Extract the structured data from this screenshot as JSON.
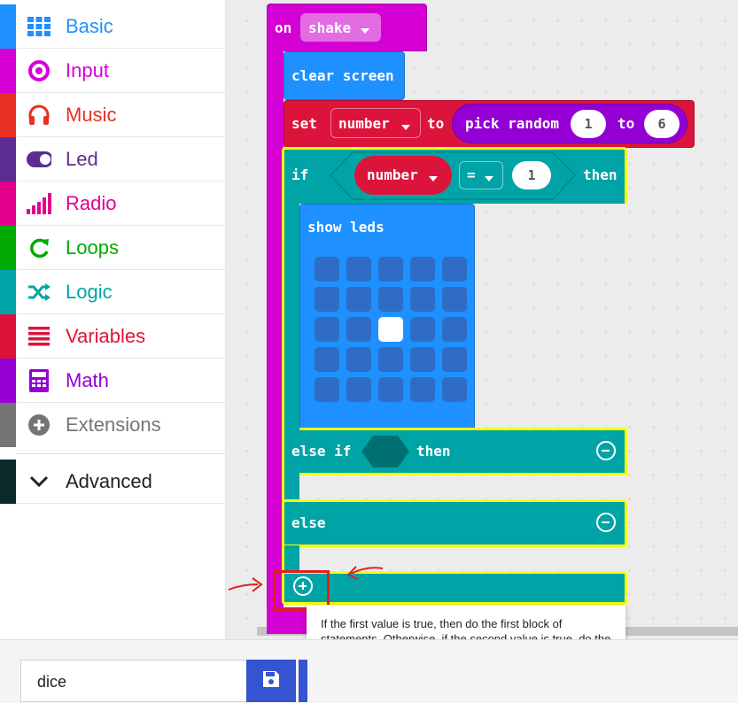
{
  "toolbox": {
    "categories": [
      {
        "label": "Basic",
        "color": "#1e90ff",
        "icon": "grid-icon"
      },
      {
        "label": "Input",
        "color": "#d400d4",
        "icon": "target-icon"
      },
      {
        "label": "Music",
        "color": "#e63022",
        "icon": "headphones-icon"
      },
      {
        "label": "Led",
        "color": "#5c2d91",
        "icon": "toggle-icon"
      },
      {
        "label": "Radio",
        "color": "#e3008c",
        "icon": "signal-bars-icon"
      },
      {
        "label": "Loops",
        "color": "#00aa00",
        "icon": "loop-arrow-icon"
      },
      {
        "label": "Logic",
        "color": "#00a4a6",
        "icon": "shuffle-icon"
      },
      {
        "label": "Variables",
        "color": "#dc143c",
        "icon": "list-lines-icon"
      },
      {
        "label": "Math",
        "color": "#9400d3",
        "icon": "calculator-icon"
      },
      {
        "label": "Extensions",
        "color": "#757575",
        "icon": "plus-circle-icon"
      }
    ],
    "advanced": {
      "label": "Advanced",
      "color": "#0c2a2c",
      "icon": "chevron-down-icon"
    }
  },
  "blocks": {
    "on_label": "on",
    "event_value": "shake",
    "clear_screen": "clear screen",
    "set_label": "set",
    "variable": "number",
    "to_label": "to",
    "pick_random": "pick random",
    "random_min": "1",
    "random_to": "to",
    "random_max": "6",
    "if_label": "if",
    "cond_variable": "number",
    "operator": "=",
    "cond_value": "1",
    "then_label": "then",
    "show_leds": "show leds",
    "led_grid": [
      [
        0,
        0,
        0,
        0,
        0
      ],
      [
        0,
        0,
        0,
        0,
        0
      ],
      [
        0,
        0,
        1,
        0,
        0
      ],
      [
        0,
        0,
        0,
        0,
        0
      ],
      [
        0,
        0,
        0,
        0,
        0
      ]
    ],
    "else_if_label": "else if",
    "else_if_then": "then",
    "else_label": "else"
  },
  "tooltip": {
    "text": "If the first value is true, then do the first block of statements. Otherwise, if the second value is true, do the second block of statements. If none of the values are true, do the last block of statements."
  },
  "footer": {
    "project_name": "dice",
    "save_icon": "floppy-disk-icon"
  },
  "colors": {
    "event": "#d400d4",
    "basic": "#1e90ff",
    "variables": "#dc143c",
    "math": "#9400d3",
    "logic": "#00a4a6",
    "highlight": "#ffff00",
    "annotation": "#e02020"
  }
}
